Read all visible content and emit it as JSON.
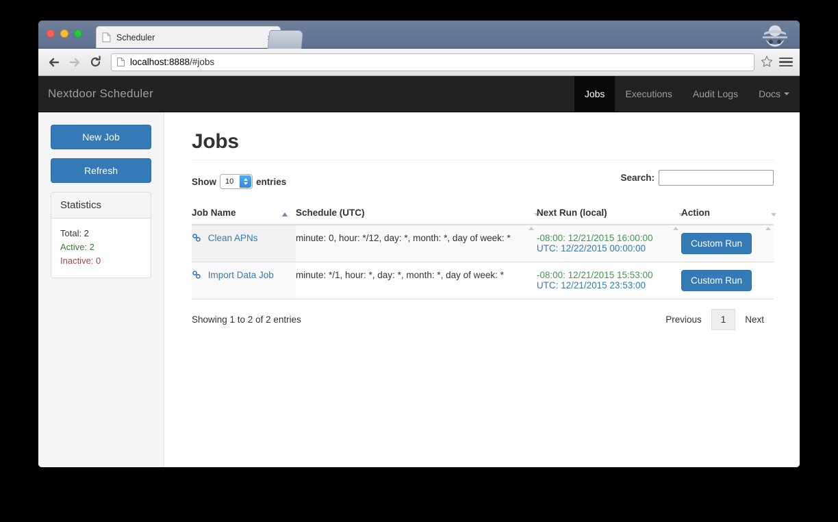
{
  "browser": {
    "tab_title": "Scheduler",
    "tab_close": "×",
    "url_scheme": "localhost:8888",
    "url_rest": "/#jobs"
  },
  "navbar": {
    "brand": "Nextdoor Scheduler",
    "items": [
      {
        "label": "Jobs",
        "active": true
      },
      {
        "label": "Executions",
        "active": false
      },
      {
        "label": "Audit Logs",
        "active": false
      },
      {
        "label": "Docs",
        "active": false,
        "caret": true
      }
    ]
  },
  "sidebar": {
    "new_job_label": "New Job",
    "refresh_label": "Refresh",
    "statistics": {
      "heading": "Statistics",
      "total": "Total: 2",
      "active": "Active: 2",
      "inactive": "Inactive: 0"
    }
  },
  "main": {
    "title": "Jobs",
    "controls": {
      "show_label": "Show",
      "entries_label": "entries",
      "page_length": "10",
      "search_label": "Search:",
      "search_value": ""
    },
    "table": {
      "headers": {
        "name": "Job Name",
        "schedule": "Schedule (UTC)",
        "next_run": "Next Run (local)",
        "action": "Action"
      },
      "rows": [
        {
          "name": "Clean APNs",
          "schedule": "minute: 0, hour: */12, day: *, month: *, day of week: *",
          "next_run_local": "-08:00: 12/21/2015 16:00:00",
          "next_run_utc": "UTC: 12/22/2015 00:00:00",
          "action_label": "Custom Run"
        },
        {
          "name": "Import Data Job",
          "schedule": "minute: */1, hour: *, day: *, month: *, day of week: *",
          "next_run_local": "-08:00: 12/21/2015 15:53:00",
          "next_run_utc": "UTC: 12/21/2015 23:53:00",
          "action_label": "Custom Run"
        }
      ]
    },
    "footer": {
      "info": "Showing 1 to 2 of 2 entries",
      "previous": "Previous",
      "page_number": "1",
      "next": "Next"
    }
  },
  "colors": {
    "primary": "#337ab7",
    "navbar": "#222222",
    "active_green": "#3c763d",
    "inactive_red": "#a94442",
    "next_run_local": "#3c9a4e"
  }
}
